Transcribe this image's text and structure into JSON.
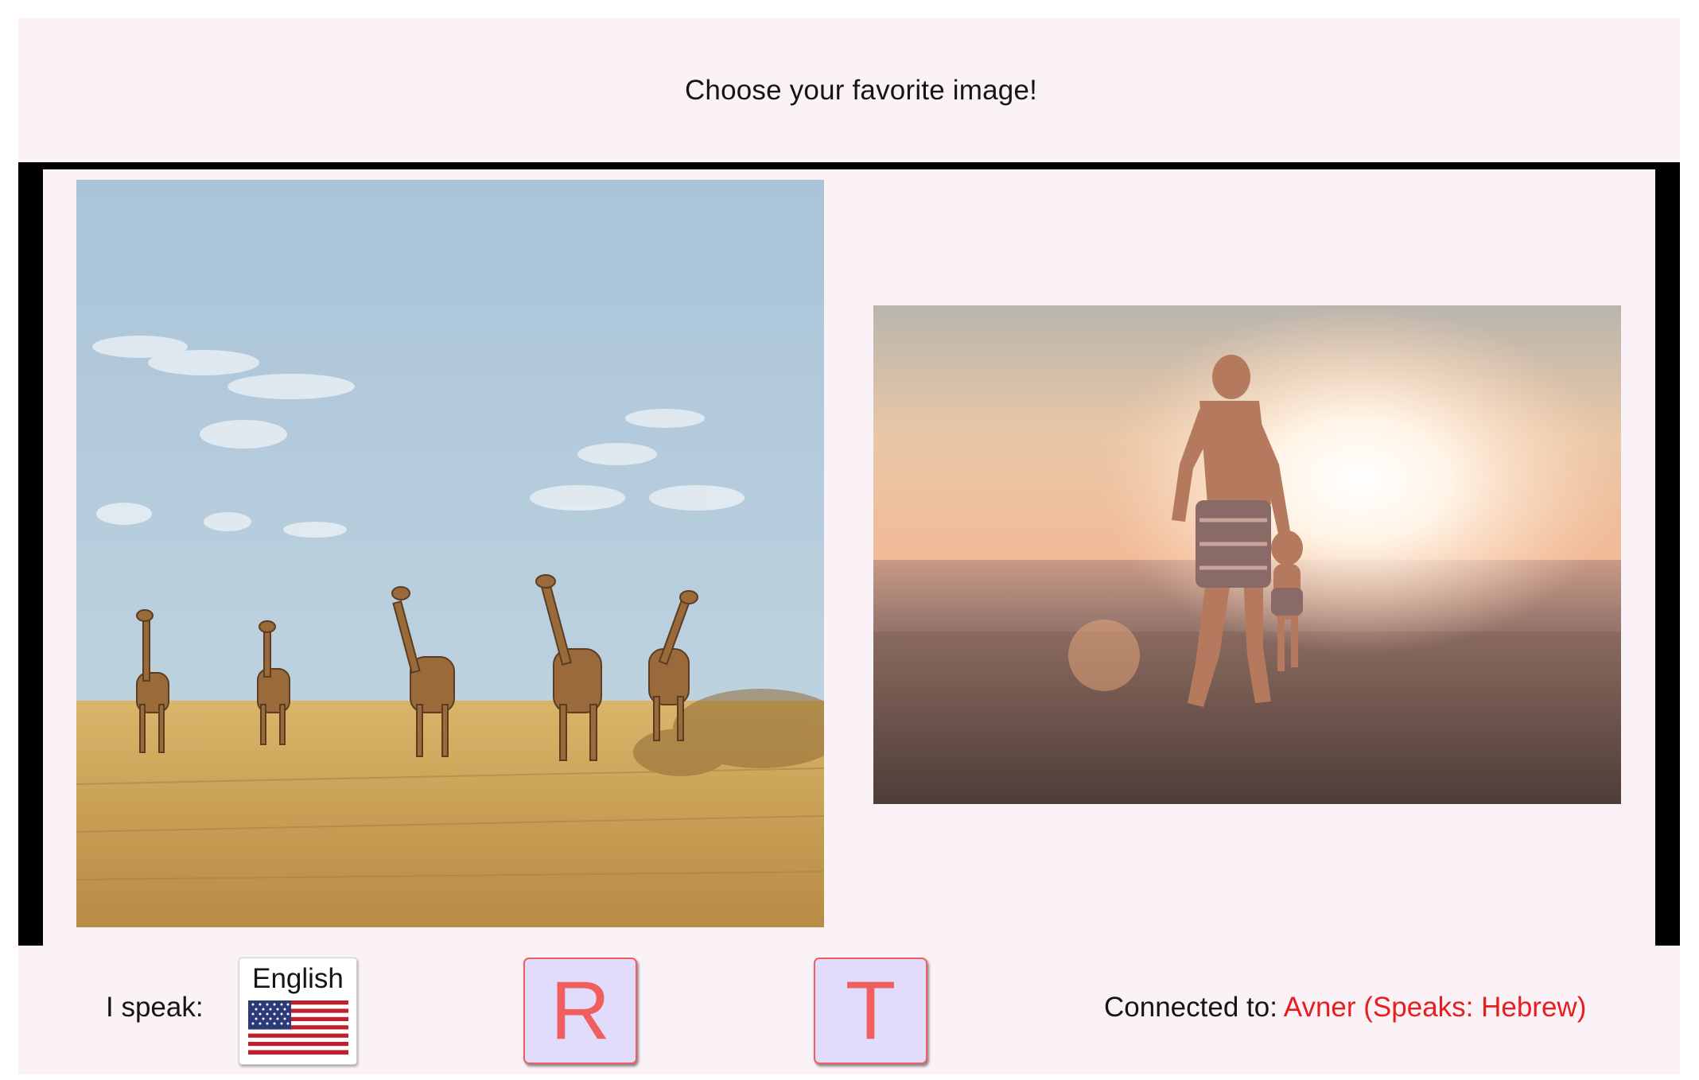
{
  "header": {
    "title": "Choose your favorite image!"
  },
  "images": [
    {
      "subject": "giraffes on savanna"
    },
    {
      "subject": "father and child walking on beach at sunset"
    }
  ],
  "footer": {
    "speak_label": "I speak:",
    "language": {
      "name": "English",
      "flag_icon": "us-flag-icon"
    },
    "buttons": [
      {
        "label": "R"
      },
      {
        "label": "T"
      }
    ],
    "connected_label": "Connected to:",
    "connected_peer": "Avner (Speaks: Hebrew)"
  },
  "colors": {
    "background": "#fbf2f8",
    "frame": "#000000",
    "accent_red": "#e81d1d",
    "button_fill": "#e1dcfb",
    "button_text": "#f05e5e"
  }
}
